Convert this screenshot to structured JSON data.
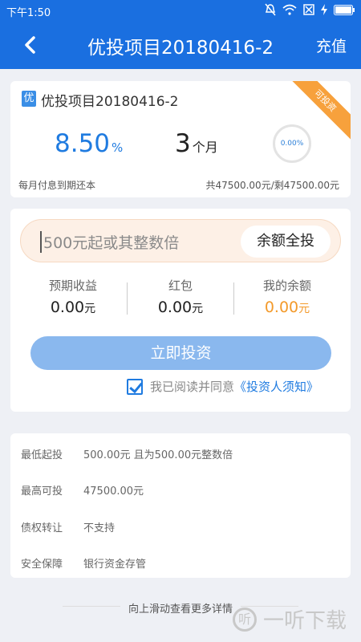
{
  "status_bar": {
    "time": "下午1:50"
  },
  "nav": {
    "title": "优投项目20180416-2",
    "recharge_label": "充值"
  },
  "project": {
    "badge": "优",
    "name": "优投项目20180416-2",
    "ribbon": "可投资",
    "rate": "8.50",
    "rate_unit": "%",
    "term": "3",
    "term_unit": "个月",
    "progress": "0.00%",
    "repay_method": "每月付息到期还本",
    "amounts": "共47500.00元/剩47500.00元"
  },
  "invest": {
    "placeholder": "500元起或其整数倍",
    "all_in_label": "余额全投",
    "stats": [
      {
        "label": "预期收益",
        "value": "0.00",
        "unit": "元"
      },
      {
        "label": "红包",
        "value": "0.00",
        "unit": "元"
      },
      {
        "label": "我的余额",
        "value": "0.00",
        "unit": "元"
      }
    ],
    "button_label": "立即投资",
    "agree_text": "我已阅读并同意",
    "agree_link": "《投资人须知》"
  },
  "details": [
    {
      "key": "最低起投",
      "value": "500.00元 且为500.00元整数倍"
    },
    {
      "key": "最高可投",
      "value": "47500.00元"
    },
    {
      "key": "债权转让",
      "value": "不支持"
    },
    {
      "key": "安全保障",
      "value": "银行资金存管"
    }
  ],
  "footer": {
    "more": "向上滑动查看更多详情",
    "watermark": "一听下载",
    "watermark_logo": "听"
  },
  "colors": {
    "primary": "#1a6fe0",
    "accent_orange": "#f39a2b",
    "button_disabled": "#8ab8ee"
  }
}
